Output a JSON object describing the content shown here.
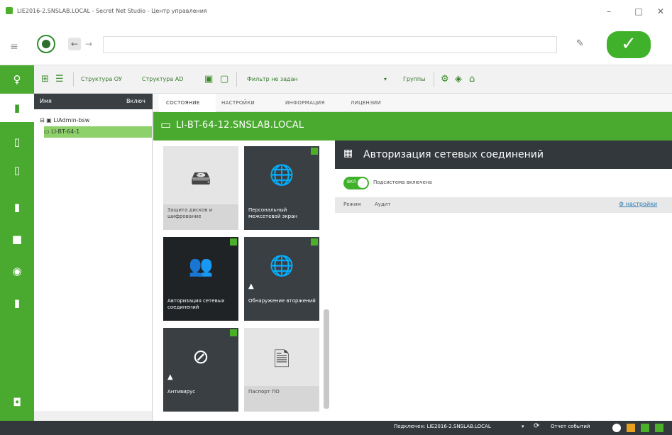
{
  "window": {
    "title": "LIE2016-2.SNSLAB.LOCAL - Secret Net Studio - Центр управления",
    "minimize_glyph": "–",
    "maximize_glyph": "□",
    "close_glyph": "✕"
  },
  "addressbar": {
    "url_value": "",
    "back_glyph": "←",
    "forward_glyph": "→",
    "menu_glyph": "≡",
    "pin_glyph": "✎",
    "apply_glyph": "✓"
  },
  "toolbar": {
    "structure_os": "Структура ОУ",
    "structure_ad": "Структура AD",
    "filter": "Фильтр не задан",
    "filter_caret": "▾",
    "groups": "Группы"
  },
  "tree": {
    "col_name": "Имя",
    "col_role": "Включ",
    "rows": [
      {
        "label": "LIAdmin-bsw",
        "selected": false
      },
      {
        "label": "LI-BT-64-1",
        "selected": true
      }
    ]
  },
  "tabs": [
    "СОСТОЯНИЕ",
    "НАСТРОЙКИ",
    "ИНФОРМАЦИЯ",
    "ЛИЦЕНЗИИ"
  ],
  "host": {
    "name": "LI-BT-64-12.SNSLAB.LOCAL"
  },
  "tiles": [
    {
      "label": "Защита дисков и шифрование",
      "theme": "light",
      "icon": "disk-shield-icon",
      "glyph": "🖴",
      "warn": false,
      "checked": false
    },
    {
      "label": "Персональный межсетевой экран",
      "theme": "dark",
      "icon": "globe-firewall-icon",
      "glyph": "🌐",
      "warn": false,
      "checked": true
    },
    {
      "label": "Авторизация сетевых соединений",
      "theme": "selected",
      "icon": "network-users-icon",
      "glyph": "👥",
      "warn": false,
      "checked": true
    },
    {
      "label": "Обнаружение вторжений",
      "theme": "dark",
      "icon": "globe-shield-icon",
      "glyph": "🌐",
      "warn": true,
      "checked": true
    },
    {
      "label": "Антивирус",
      "theme": "dark",
      "icon": "antivirus-icon",
      "glyph": "⊘",
      "warn": true,
      "checked": true
    },
    {
      "label": "Паспорт ПО",
      "theme": "light",
      "icon": "document-icon",
      "glyph": "🗎",
      "warn": false,
      "checked": false
    }
  ],
  "detail": {
    "title": "Авторизация сетевых соединений",
    "toggle_label": "Подсистема включена",
    "toggle_state": "ВКЛ",
    "mode_label": "Режим",
    "mode_value": "Аудит",
    "settings_link": "настройки"
  },
  "statusbar": {
    "connection": "Подключен: LIE2016-2.SNSLAB.LOCAL",
    "caret": "▾",
    "global_scope": "Отчет событий"
  },
  "colors": {
    "accent": "#4aaa2f",
    "dark": "#33383d"
  }
}
